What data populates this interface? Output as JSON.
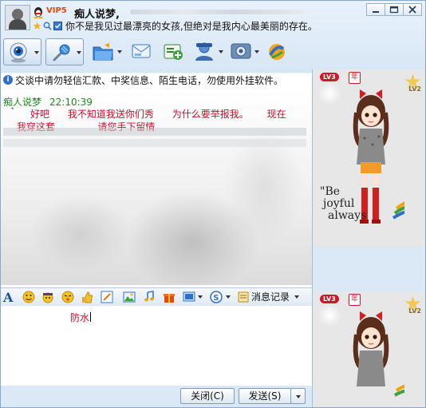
{
  "title": {
    "vip_badge": "VIP5",
    "nickname": "痴人说梦,",
    "signature": "你不是我见过最漂亮的女孩,但绝对是我内心最美丽的存在。"
  },
  "notice": {
    "text": "交谈中请勿轻信汇款、中奖信息、陌生电话，勿使用外挂软件。"
  },
  "chat": {
    "sender": "痴人说梦",
    "time": "22:10:39",
    "lines": [
      "好吧      我不知道我送你们秀      为什么要举报我。      现在",
      "我穿这套              请您手下留情"
    ]
  },
  "format_bar": {
    "records_label": "消息记录"
  },
  "input": {
    "value": "防水"
  },
  "buttons": {
    "close": "关闭(C)",
    "send": "发送(S)"
  },
  "show_panel": {
    "level": "LV3",
    "year_badge": "年",
    "level2": "LV2",
    "slogan": [
      "\"Be",
      "joyful",
      "always"
    ]
  },
  "colors": {
    "chat_sender": "#1b8a1b",
    "chat_text": "#c8102e",
    "frame": "#dbe8f5"
  }
}
